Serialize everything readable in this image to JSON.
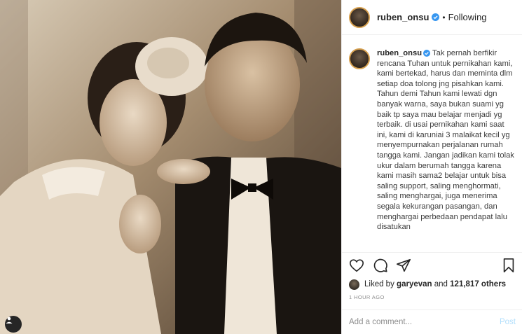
{
  "post": {
    "photo_alt": "",
    "tag_icon": "user-tag-icon"
  },
  "header": {
    "username": "ruben_onsu",
    "verified_icon": "verified-badge-icon",
    "separator": "•",
    "follow_status": "Following"
  },
  "caption": {
    "username": "ruben_onsu",
    "text": "Tak pernah berfikir rencana Tuhan untuk pernikahan kami, kami bertekad, harus dan meminta dlm setiap doa tolong jng pisahkan kami. Tahun demi Tahun kami lewati dgn banyak warna, saya bukan suami yg baik tp saya mau belajar menjadi yg terbaik. di usai pernikahan kami saat ini, kami di karuniai 3 malaikat kecil yg menyempurnakan perjalanan rumah tangga kami. Jangan jadikan kami tolak ukur dalam berumah tangga karena kami masih sama2 belajar untuk bisa saling support, saling menghormati, saling menghargai, juga menerima segala kekurangan pasangan, dan menghargai perbedaan pendapat lalu disatukan"
  },
  "actions": {
    "like_icon": "heart-icon",
    "comment_icon": "comment-icon",
    "share_icon": "share-icon",
    "save_icon": "bookmark-icon"
  },
  "likes": {
    "prefix": "Liked by",
    "user": "garyevan",
    "conjunction": "and",
    "others": "121,817 others"
  },
  "timestamp": "1 HOUR AGO",
  "comment": {
    "placeholder": "Add a comment...",
    "post_label": "Post"
  },
  "colors": {
    "verified_blue": "#3897f0",
    "post_disabled": "#b2dffc",
    "muted": "#8e8e8e",
    "text": "#262626"
  }
}
